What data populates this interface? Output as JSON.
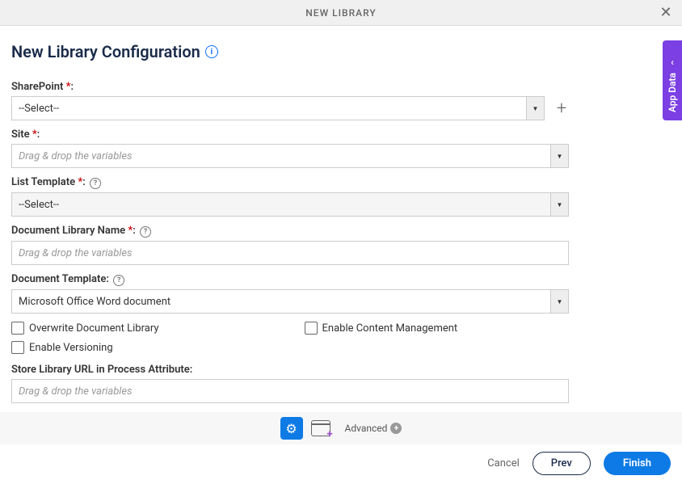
{
  "header": {
    "title": "NEW LIBRARY"
  },
  "page_title": "New Library Configuration",
  "fields": {
    "sharepoint": {
      "label": "SharePoint",
      "value": "--Select--"
    },
    "site": {
      "label": "Site",
      "placeholder": "Drag & drop the variables"
    },
    "list_template": {
      "label": "List Template",
      "value": "--Select--"
    },
    "doc_lib_name": {
      "label": "Document Library Name",
      "placeholder": "Drag & drop the variables"
    },
    "doc_template": {
      "label": "Document Template:",
      "value": "Microsoft Office Word document"
    },
    "overwrite": {
      "label": "Overwrite Document Library"
    },
    "enable_content": {
      "label": "Enable Content Management"
    },
    "enable_versioning": {
      "label": "Enable Versioning"
    },
    "store_url": {
      "label": "Store Library URL in Process Attribute:",
      "placeholder": "Drag & drop the variables"
    }
  },
  "side_tab": "App Data",
  "footer": {
    "advanced": "Advanced"
  },
  "actions": {
    "cancel": "Cancel",
    "prev": "Prev",
    "finish": "Finish"
  }
}
